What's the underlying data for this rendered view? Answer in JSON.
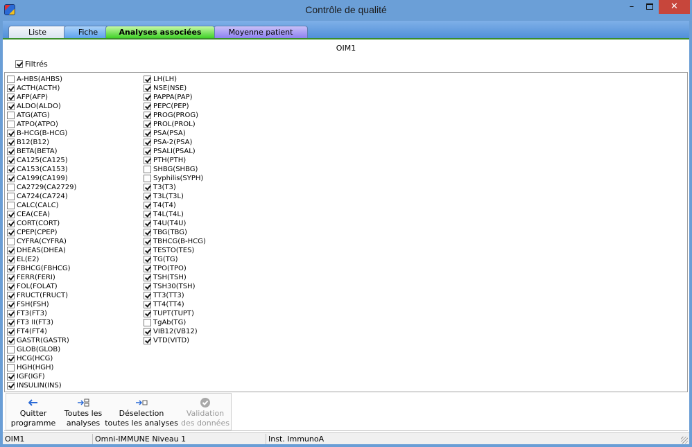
{
  "window": {
    "title": "Contrôle de qualité",
    "min": "–",
    "close": "✕"
  },
  "tabs": [
    {
      "label": "Liste"
    },
    {
      "label": "Fiche"
    },
    {
      "label": "Analyses associées"
    },
    {
      "label": "Moyenne patient"
    }
  ],
  "header": {
    "code": "OIM1"
  },
  "filter": {
    "label": "Filtrés",
    "checked": true
  },
  "analyses_col1": [
    {
      "label": "A-HBS(AHBS)",
      "checked": false
    },
    {
      "label": "ACTH(ACTH)",
      "checked": true
    },
    {
      "label": "AFP(AFP)",
      "checked": true
    },
    {
      "label": "ALDO(ALDO)",
      "checked": true
    },
    {
      "label": "ATG(ATG)",
      "checked": false
    },
    {
      "label": "ATPO(ATPO)",
      "checked": false
    },
    {
      "label": "B-HCG(B-HCG)",
      "checked": true
    },
    {
      "label": "B12(B12)",
      "checked": true
    },
    {
      "label": "BETA(BETA)",
      "checked": true
    },
    {
      "label": "CA125(CA125)",
      "checked": true
    },
    {
      "label": "CA153(CA153)",
      "checked": true
    },
    {
      "label": "CA199(CA199)",
      "checked": true
    },
    {
      "label": "CA2729(CA2729)",
      "checked": false
    },
    {
      "label": "CA724(CA724)",
      "checked": false
    },
    {
      "label": "CALC(CALC)",
      "checked": false
    },
    {
      "label": "CEA(CEA)",
      "checked": true
    },
    {
      "label": "CORT(CORT)",
      "checked": true
    },
    {
      "label": "CPEP(CPEP)",
      "checked": true
    },
    {
      "label": "CYFRA(CYFRA)",
      "checked": false
    },
    {
      "label": "DHEAS(DHEA)",
      "checked": true
    },
    {
      "label": "EL(E2)",
      "checked": true
    },
    {
      "label": "FBHCG(FBHCG)",
      "checked": true
    },
    {
      "label": "FERR(FERI)",
      "checked": true
    },
    {
      "label": "FOL(FOLAT)",
      "checked": true
    },
    {
      "label": "FRUCT(FRUCT)",
      "checked": true
    },
    {
      "label": "FSH(FSH)",
      "checked": true
    },
    {
      "label": "FT3(FT3)",
      "checked": true
    },
    {
      "label": "FT3 II(FT3)",
      "checked": true
    },
    {
      "label": "FT4(FT4)",
      "checked": true
    },
    {
      "label": "GASTR(GASTR)",
      "checked": true
    },
    {
      "label": "GLOB(GLOB)",
      "checked": false
    },
    {
      "label": "HCG(HCG)",
      "checked": true
    },
    {
      "label": "HGH(HGH)",
      "checked": false
    },
    {
      "label": "IGF(IGF)",
      "checked": true
    },
    {
      "label": "INSULIN(INS)",
      "checked": true
    }
  ],
  "analyses_col2": [
    {
      "label": "LH(LH)",
      "checked": true
    },
    {
      "label": "NSE(NSE)",
      "checked": true
    },
    {
      "label": "PAPPA(PAP)",
      "checked": true
    },
    {
      "label": "PEPC(PEP)",
      "checked": true
    },
    {
      "label": "PROG(PROG)",
      "checked": true
    },
    {
      "label": "PROL(PROL)",
      "checked": true
    },
    {
      "label": "PSA(PSA)",
      "checked": true
    },
    {
      "label": "PSA-2(PSA)",
      "checked": true
    },
    {
      "label": "PSALI(PSAL)",
      "checked": true
    },
    {
      "label": "PTH(PTH)",
      "checked": true
    },
    {
      "label": "SHBG(SHBG)",
      "checked": false
    },
    {
      "label": "Syphilis(SYPH)",
      "checked": false
    },
    {
      "label": "T3(T3)",
      "checked": true
    },
    {
      "label": "T3L(T3L)",
      "checked": true
    },
    {
      "label": "T4(T4)",
      "checked": true
    },
    {
      "label": "T4L(T4L)",
      "checked": true
    },
    {
      "label": "T4U(T4U)",
      "checked": true
    },
    {
      "label": "TBG(TBG)",
      "checked": true
    },
    {
      "label": "TBHCG(B-HCG)",
      "checked": true
    },
    {
      "label": "TESTO(TES)",
      "checked": true
    },
    {
      "label": "TG(TG)",
      "checked": true
    },
    {
      "label": "TPO(TPO)",
      "checked": true
    },
    {
      "label": "TSH(TSH)",
      "checked": true
    },
    {
      "label": "TSH30(TSH)",
      "checked": true
    },
    {
      "label": "TT3(TT3)",
      "checked": true
    },
    {
      "label": "TT4(TT4)",
      "checked": true
    },
    {
      "label": "TUPT(TUPT)",
      "checked": true
    },
    {
      "label": "TgAb(TG)",
      "checked": false
    },
    {
      "label": "VIB12(VB12)",
      "checked": true
    },
    {
      "label": "VTD(VITD)",
      "checked": true
    }
  ],
  "toolbar": {
    "quit": {
      "line1": "Quitter",
      "line2": "programme"
    },
    "select_all": {
      "line1": "Toutes les",
      "line2": "analyses"
    },
    "deselect": {
      "line1": "Déselection",
      "line2": "toutes les analyses"
    },
    "validate": {
      "line1": "Validation",
      "line2": "des données",
      "enabled": false
    }
  },
  "status": {
    "code": "OIM1",
    "control": "Omni-IMMUNE Niveau 1",
    "instrument": "Inst. ImmunoA"
  },
  "colors": {
    "title_bar": "#6b9fd7",
    "close_button": "#c7463b",
    "tab_active": "#38d020",
    "tab_fiche": "#5aa0ec",
    "tab_moyenne": "#8a7ef0"
  }
}
